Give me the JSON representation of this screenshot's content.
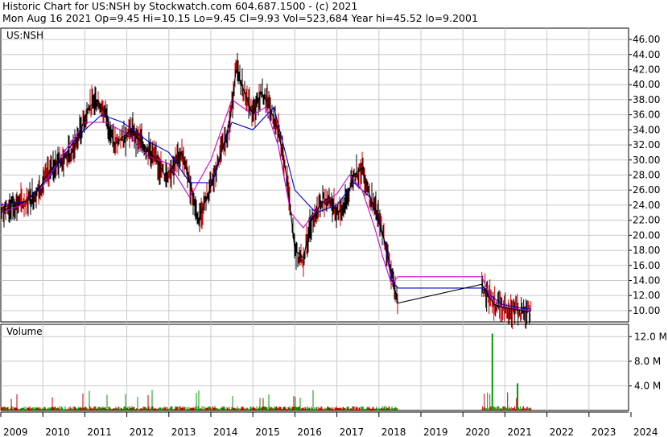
{
  "header": {
    "line1": "Historic Chart for US:NSH by Stockwatch.com 604.687.1500 - (c) 2021",
    "line2": "Mon Aug 16 2021   Op=9.45   Hi=10.15   Lo=9.45   Cl=9.93   Vol=523,684   Year hi=45.52   lo=9.2001"
  },
  "chart_data": [
    {
      "type": "line",
      "title": "US:NSH",
      "ylim": [
        8.5,
        47.5
      ],
      "y_ticks": [
        "46.00",
        "44.00",
        "42.00",
        "40.00",
        "38.00",
        "36.00",
        "34.00",
        "32.00",
        "30.00",
        "28.00",
        "26.00",
        "24.00",
        "22.00",
        "20.00",
        "18.00",
        "16.00",
        "14.00",
        "12.00",
        "10.00"
      ],
      "x_ticks": [
        "2009",
        "2010",
        "2011",
        "2012",
        "2013",
        "2014",
        "2015",
        "2016",
        "2017",
        "2018",
        "2019",
        "2020",
        "2021",
        "2022",
        "2023",
        "2024"
      ],
      "colors": {
        "price": "#000000",
        "ma_short": "#cc00cc",
        "ma_long": "#0000cc"
      },
      "series": [
        {
          "x": [
            2009.0,
            2009.3,
            2009.6,
            2009.9,
            2010.1,
            2010.4,
            2010.7,
            2010.9,
            2011.1,
            2011.3,
            2011.5,
            2011.7,
            2011.9,
            2012.1,
            2012.4,
            2012.7,
            2012.9,
            2013.1,
            2013.3,
            2013.5,
            2013.7,
            2013.9,
            2014.1,
            2014.3,
            2014.45,
            2014.6,
            2014.8,
            2015.0,
            2015.2,
            2015.4,
            2015.6,
            2015.8,
            2016.0,
            2016.2,
            2016.4,
            2016.6,
            2016.8,
            2017.0,
            2017.2,
            2017.4,
            2017.6,
            2017.8,
            2018.0,
            2018.15,
            2018.3,
            2018.45,
            2020.45,
            2020.6,
            2020.75,
            2020.9,
            2021.1,
            2021.3,
            2021.45,
            2021.62
          ],
          "values": [
            23,
            24,
            24.5,
            26,
            28,
            30,
            31,
            34,
            37,
            38,
            36,
            32,
            33,
            34,
            32,
            30,
            28,
            29,
            31,
            27,
            22,
            25,
            28,
            32,
            35,
            42,
            39,
            36,
            39,
            37,
            34,
            28,
            18,
            17,
            22,
            24,
            25,
            23,
            24,
            28,
            29,
            25,
            22,
            19,
            15,
            11,
            13.5,
            12,
            10.8,
            10.5,
            10.3,
            10.1,
            9.9,
            9.93
          ]
        },
        {
          "x": [
            2009.0,
            2009.5,
            2010.0,
            2010.5,
            2011.0,
            2011.5,
            2012.0,
            2012.5,
            2013.0,
            2013.5,
            2014.0,
            2014.5,
            2015.0,
            2015.3,
            2015.6,
            2015.9,
            2016.2,
            2016.6,
            2017.0,
            2017.3,
            2017.6,
            2017.9,
            2018.1,
            2018.3,
            2018.45,
            2020.45,
            2020.7,
            2020.95,
            2021.3,
            2021.62
          ],
          "values": [
            23,
            24,
            26.5,
            31,
            35,
            35,
            33.5,
            30.5,
            29.5,
            25,
            30,
            38,
            36,
            37,
            32,
            23,
            21,
            24,
            25.5,
            28,
            26,
            21,
            17,
            13.5,
            14.5,
            14.5,
            11.3,
            10.5,
            10.2,
            10.0
          ]
        },
        {
          "x": [
            2009.0,
            2009.6,
            2010.2,
            2010.8,
            2011.4,
            2011.9,
            2012.5,
            2013.0,
            2013.5,
            2014.0,
            2014.5,
            2015.0,
            2015.5,
            2016.0,
            2016.5,
            2017.0,
            2017.4,
            2017.8,
            2018.1,
            2018.3,
            2018.45,
            2020.45,
            2020.7,
            2020.95,
            2021.3,
            2021.62
          ],
          "values": [
            24,
            24.5,
            28,
            33,
            36,
            35,
            32.5,
            31,
            27,
            27,
            35,
            34,
            37,
            26,
            23,
            24,
            27,
            25,
            20,
            14,
            13,
            13,
            11.8,
            10.8,
            10.4,
            10.2
          ]
        }
      ]
    },
    {
      "type": "bar",
      "title": "Volume",
      "ylim": [
        0,
        14000000
      ],
      "y_ticks": [
        "12.0 M",
        "8.0 M",
        "4.0 M"
      ],
      "series": [
        {
          "x": [
            2020.7,
            2021.3
          ],
          "values": [
            12500000,
            4400000
          ]
        }
      ]
    }
  ]
}
